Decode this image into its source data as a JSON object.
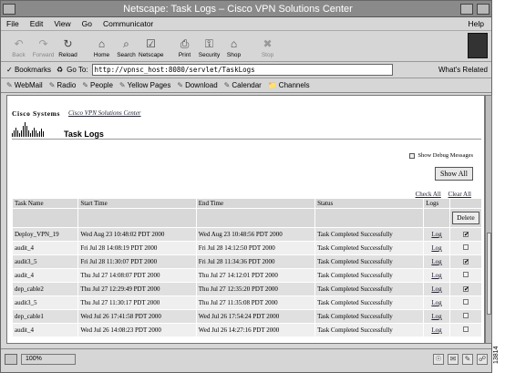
{
  "window": {
    "title": "Netscape: Task Logs – Cisco VPN Solutions Center"
  },
  "menu": {
    "items": [
      "File",
      "Edit",
      "View",
      "Go",
      "Communicator"
    ],
    "help": "Help"
  },
  "toolbar": {
    "buttons": [
      {
        "label": "Back",
        "icon": "back-arrow-icon",
        "glyph": "↶",
        "enabled": false
      },
      {
        "label": "Forward",
        "icon": "forward-arrow-icon",
        "glyph": "↷",
        "enabled": false
      },
      {
        "label": "Reload",
        "icon": "reload-icon",
        "glyph": "↻",
        "enabled": true
      },
      {
        "label": "Home",
        "icon": "home-icon",
        "glyph": "⌂",
        "enabled": true
      },
      {
        "label": "Search",
        "icon": "search-icon",
        "glyph": "⌕",
        "enabled": true
      },
      {
        "label": "Netscape",
        "icon": "netscape-icon",
        "glyph": "☑",
        "enabled": true
      },
      {
        "label": "Print",
        "icon": "print-icon",
        "glyph": "⎙",
        "enabled": true
      },
      {
        "label": "Security",
        "icon": "lock-icon",
        "glyph": "⚿",
        "enabled": true
      },
      {
        "label": "Shop",
        "icon": "shop-icon",
        "glyph": "⌂",
        "enabled": true
      },
      {
        "label": "Stop",
        "icon": "stop-icon",
        "glyph": "✖",
        "enabled": false
      }
    ]
  },
  "location": {
    "bookmarks": "Bookmarks",
    "goto": "Go To:",
    "url": "http://vpnsc_host:8080/servlet/TaskLogs",
    "related": "What's Related"
  },
  "personal": {
    "items": [
      "WebMail",
      "Radio",
      "People",
      "Yellow Pages",
      "Download",
      "Calendar",
      "Channels"
    ]
  },
  "page": {
    "company": "Cisco Systems",
    "product": "Cisco VPN Solutions Center",
    "title": "Task Logs",
    "debug_label": "Show Debug Messages",
    "show_all": "Show All",
    "check_all": "Check All",
    "clear_all": "Clear All",
    "delete": "Delete",
    "columns": [
      "Task Name",
      "Start Time",
      "End Time",
      "Status",
      "Logs",
      ""
    ],
    "rows": [
      {
        "name": "Deploy_VPN_19",
        "start": "Wed Aug 23 10:48:02 PDT 2000",
        "end": "Wed Aug 23 10:48:56 PDT 2000",
        "status": "Task Completed Successfully",
        "log": "Log",
        "checked": true
      },
      {
        "name": "audit_4",
        "start": "Fri Jul 28 14:08:19 PDT 2000",
        "end": "Fri Jul 28 14:12:50 PDT 2000",
        "status": "Task Completed Successfully",
        "log": "Log",
        "checked": false
      },
      {
        "name": "audit3_5",
        "start": "Fri Jul 28 11:30:07 PDT 2000",
        "end": "Fri Jul 28 11:34:36 PDT 2000",
        "status": "Task Completed Successfully",
        "log": "Log",
        "checked": true
      },
      {
        "name": "audit_4",
        "start": "Thu Jul 27 14:08:07 PDT 2000",
        "end": "Thu Jul 27 14:12:01 PDT 2000",
        "status": "Task Completed Successfully",
        "log": "Log",
        "checked": false
      },
      {
        "name": "dep_cable2",
        "start": "Thu Jul 27 12:29:49 PDT 2000",
        "end": "Thu Jul 27 12:35:20 PDT 2000",
        "status": "Task Completed Successfully",
        "log": "Log",
        "checked": true
      },
      {
        "name": "audit3_5",
        "start": "Thu Jul 27 11:30:17 PDT 2000",
        "end": "Thu Jul 27 11:35:08 PDT 2000",
        "status": "Task Completed Successfully",
        "log": "Log",
        "checked": false
      },
      {
        "name": "dep_cable1",
        "start": "Wed Jul 26 17:41:58 PDT 2000",
        "end": "Wed Jul 26 17:54:24 PDT 2000",
        "status": "Task Completed Successfully",
        "log": "Log",
        "checked": false
      },
      {
        "name": "audit_4",
        "start": "Wed Jul 26 14:08:23 PDT 2000",
        "end": "Wed Jul 26 14:27:16 PDT 2000",
        "status": "Task Completed Successfully",
        "log": "Log",
        "checked": false
      }
    ]
  },
  "status": {
    "zoom": "100%"
  },
  "figure_id": "13814"
}
